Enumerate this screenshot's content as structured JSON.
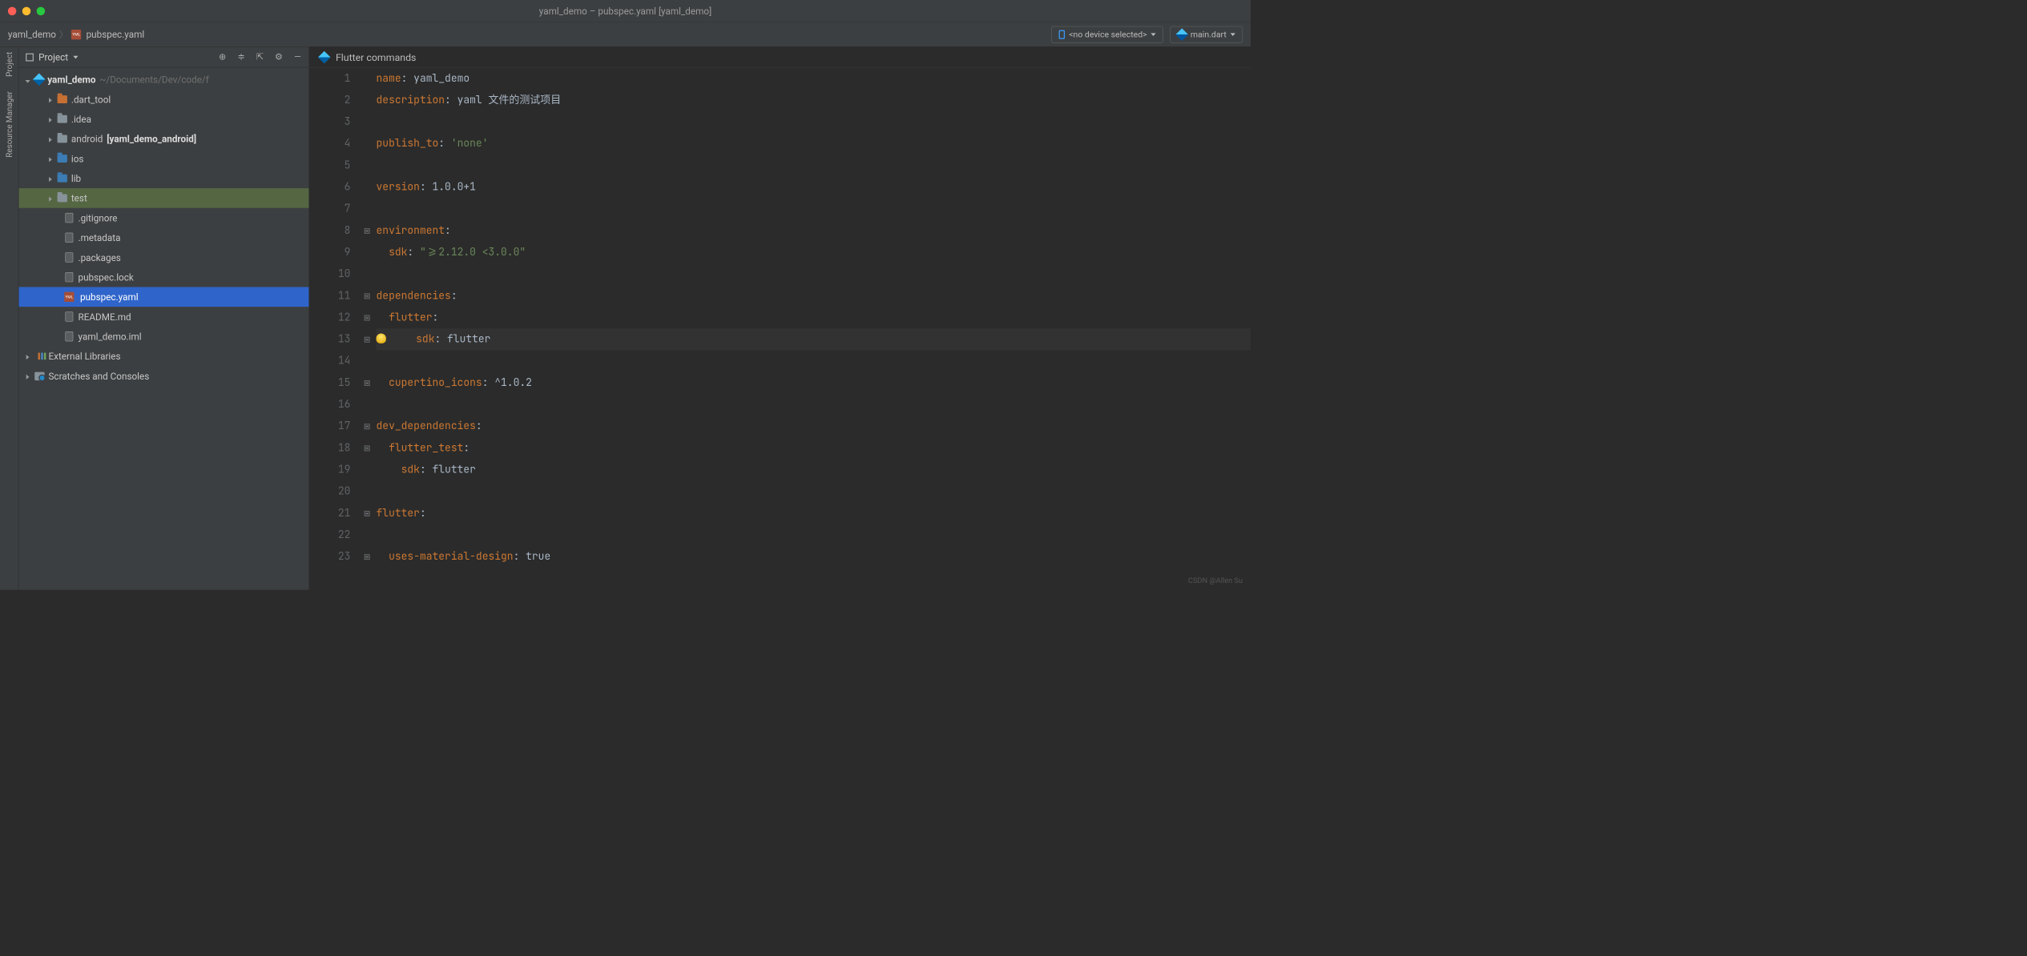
{
  "window_title": "yaml_demo – pubspec.yaml [yaml_demo]",
  "breadcrumb": {
    "project": "yaml_demo",
    "file": "pubspec.yaml"
  },
  "device_selector": "<no device selected>",
  "run_config": "main.dart",
  "gutter": {
    "project": "Project",
    "res_mgr": "Resource Manager"
  },
  "panel": {
    "title": "Project"
  },
  "tree": {
    "root": {
      "name": "yaml_demo",
      "path": "~/Documents/Dev/code/f"
    },
    "folders": [
      {
        "name": ".dart_tool",
        "type": "orange"
      },
      {
        "name": ".idea",
        "type": "mod"
      },
      {
        "name": "android",
        "suffix": "[yaml_demo_android]",
        "type": "mod"
      },
      {
        "name": "ios",
        "type": "blue"
      },
      {
        "name": "lib",
        "type": "blue"
      },
      {
        "name": "test",
        "type": "mod",
        "highlighted": true
      }
    ],
    "files": [
      {
        "name": ".gitignore"
      },
      {
        "name": ".metadata"
      },
      {
        "name": ".packages"
      },
      {
        "name": "pubspec.lock"
      },
      {
        "name": "pubspec.yaml",
        "selected": true,
        "yaml": true
      },
      {
        "name": "README.md"
      },
      {
        "name": "yaml_demo.iml"
      }
    ],
    "ext_libs": "External Libraries",
    "scratches": "Scratches and Consoles"
  },
  "editor": {
    "toolbar": "Flutter commands",
    "lines": [
      {
        "n": 1,
        "tokens": [
          {
            "t": "key",
            "v": "name"
          },
          {
            "t": "plain",
            "v": ": yaml_demo"
          }
        ]
      },
      {
        "n": 2,
        "tokens": [
          {
            "t": "key",
            "v": "description"
          },
          {
            "t": "plain",
            "v": ": yaml 文件的测试项目"
          }
        ]
      },
      {
        "n": 3,
        "tokens": []
      },
      {
        "n": 4,
        "tokens": [
          {
            "t": "key",
            "v": "publish_to"
          },
          {
            "t": "plain",
            "v": ": "
          },
          {
            "t": "str",
            "v": "'none'"
          }
        ]
      },
      {
        "n": 5,
        "tokens": []
      },
      {
        "n": 6,
        "tokens": [
          {
            "t": "key",
            "v": "version"
          },
          {
            "t": "plain",
            "v": ": 1.0.0+1"
          }
        ]
      },
      {
        "n": 7,
        "tokens": []
      },
      {
        "n": 8,
        "tokens": [
          {
            "t": "key",
            "v": "environment"
          },
          {
            "t": "plain",
            "v": ":"
          }
        ],
        "fold": true
      },
      {
        "n": 9,
        "tokens": [
          {
            "t": "plain",
            "v": "  "
          },
          {
            "t": "key",
            "v": "sdk"
          },
          {
            "t": "plain",
            "v": ": "
          },
          {
            "t": "str",
            "v": "\">=2.12.0 <3.0.0\""
          }
        ]
      },
      {
        "n": 10,
        "tokens": []
      },
      {
        "n": 11,
        "tokens": [
          {
            "t": "key",
            "v": "dependencies"
          },
          {
            "t": "plain",
            "v": ":"
          }
        ],
        "fold": true
      },
      {
        "n": 12,
        "tokens": [
          {
            "t": "plain",
            "v": "  "
          },
          {
            "t": "key",
            "v": "flutter"
          },
          {
            "t": "plain",
            "v": ":"
          }
        ],
        "fold": true
      },
      {
        "n": 13,
        "cursor": true,
        "bulb": true,
        "tokens": [
          {
            "t": "plain",
            "v": "    "
          },
          {
            "t": "key",
            "v": "sdk"
          },
          {
            "t": "plain",
            "v": ": flutter"
          }
        ],
        "fold": true
      },
      {
        "n": 14,
        "tokens": []
      },
      {
        "n": 15,
        "tokens": [
          {
            "t": "plain",
            "v": "  "
          },
          {
            "t": "key",
            "v": "cupertino_icons"
          },
          {
            "t": "plain",
            "v": ": ^1.0.2"
          }
        ],
        "fold": true
      },
      {
        "n": 16,
        "tokens": []
      },
      {
        "n": 17,
        "tokens": [
          {
            "t": "key",
            "v": "dev_dependencies"
          },
          {
            "t": "plain",
            "v": ":"
          }
        ],
        "fold": true
      },
      {
        "n": 18,
        "tokens": [
          {
            "t": "plain",
            "v": "  "
          },
          {
            "t": "key",
            "v": "flutter_test"
          },
          {
            "t": "plain",
            "v": ":"
          }
        ],
        "fold": true
      },
      {
        "n": 19,
        "tokens": [
          {
            "t": "plain",
            "v": "    "
          },
          {
            "t": "key",
            "v": "sdk"
          },
          {
            "t": "plain",
            "v": ": flutter"
          }
        ]
      },
      {
        "n": 20,
        "tokens": []
      },
      {
        "n": 21,
        "tokens": [
          {
            "t": "key",
            "v": "flutter"
          },
          {
            "t": "plain",
            "v": ":"
          }
        ],
        "fold": true
      },
      {
        "n": 22,
        "tokens": []
      },
      {
        "n": 23,
        "tokens": [
          {
            "t": "plain",
            "v": "  "
          },
          {
            "t": "key",
            "v": "uses-material-design"
          },
          {
            "t": "plain",
            "v": ": true"
          }
        ],
        "fold": true
      }
    ]
  },
  "watermark": "CSDN @Allen Su"
}
